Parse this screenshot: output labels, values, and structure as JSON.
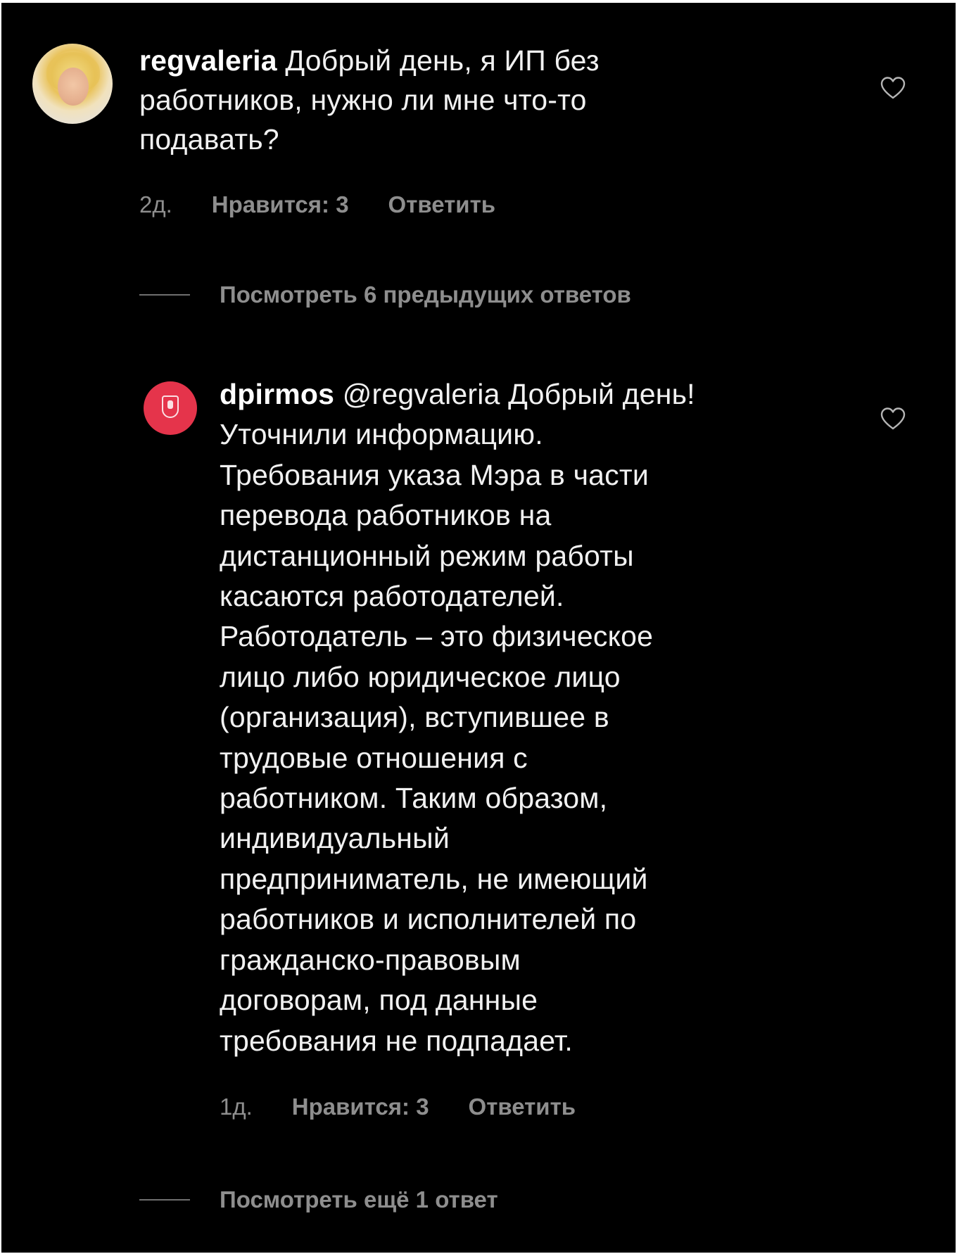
{
  "comments": [
    {
      "username": "regvaleria",
      "lines": [
        "Добрый день, я ИП без",
        "работников, нужно ли мне что-то",
        "подавать?"
      ],
      "age": "2д.",
      "likes": "Нравится: 3",
      "reply": "Ответить",
      "avatar": "user-photo",
      "like_icon": "heart-outline-icon"
    },
    {
      "username": "dpirmos",
      "lines": [
        "@regvaleria Добрый день!",
        "Уточнили информацию.",
        "Требования указа Мэра в части",
        "перевода работников на",
        "дистанционный режим работы",
        "касаются работодателей.",
        "Работодатель – это физическое",
        "лицо либо юридическое лицо",
        "(организация), вступившее в",
        "трудовые отношения с",
        "работником. Таким образом,",
        "индивидуальный",
        "предприниматель, не имеющий",
        "работников и исполнителей по",
        "гражданско-правовым",
        "договорам, под данные",
        "требования не подпадает."
      ],
      "age": "1д.",
      "likes": "Нравится: 3",
      "reply": "Ответить",
      "avatar": "moscow-emblem-logo",
      "like_icon": "heart-outline-icon"
    }
  ],
  "view_previous": "Посмотреть 6 предыдущих ответов",
  "view_more": "Посмотреть ещё 1 ответ",
  "colors": {
    "background": "#000000",
    "text": "#f1f1f1",
    "muted": "#8e8e8e",
    "logo_red": "#e5344b"
  }
}
